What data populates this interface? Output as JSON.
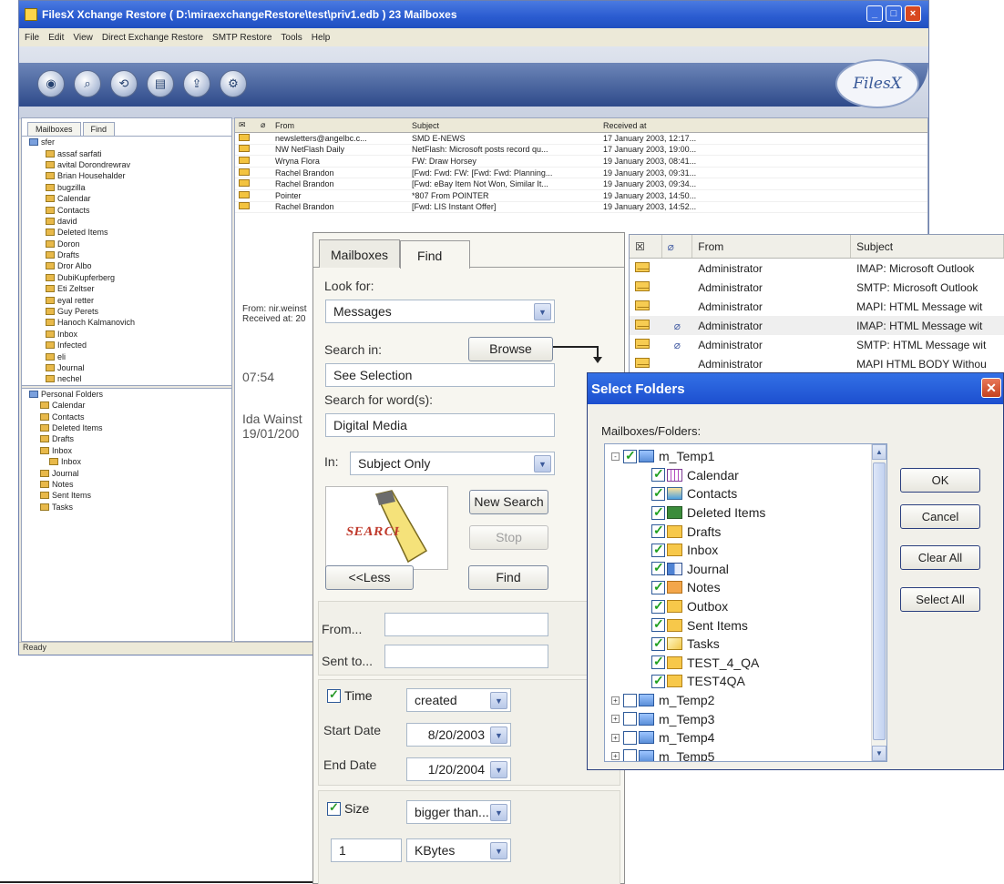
{
  "main_window": {
    "title": "FilesX Xchange Restore ( D:\\miraexchangeRestore\\test\\priv1.edb ) 23 Mailboxes",
    "menu": [
      "File",
      "Edit",
      "View",
      "Direct Exchange Restore",
      "SMTP Restore",
      "Tools",
      "Help"
    ],
    "brand": "FilesX",
    "left_tabs": [
      "Mailboxes",
      "Find"
    ],
    "mailbox_tree_root": "sfer",
    "mailbox_tree": [
      "assaf sarfati",
      "avital Dorondrewrav",
      "Brian Househalder",
      "bugzilla",
      "Calendar",
      "Contacts",
      "david",
      "Deleted Items",
      "Doron",
      "Drafts",
      "Dror Albo",
      "DubiKupferberg",
      "Eti Zeltser",
      "eyal retter",
      "Guy Perets",
      "Hanoch Kalmanovich",
      "Inbox",
      "Infected",
      "eli",
      "Journal",
      "nechel"
    ],
    "pst_tree": [
      "Personal Folders",
      "Calendar",
      "Contacts",
      "Deleted Items",
      "Drafts",
      "Inbox",
      "Inbox",
      "Journal",
      "Notes",
      "Sent Items",
      "Tasks"
    ],
    "msg_columns": [
      "From",
      "Subject",
      "Received at"
    ],
    "messages": [
      {
        "from": "newsletters@angelbc.c...",
        "subject": "SMD E-NEWS",
        "date": "17 January 2003, 12:17..."
      },
      {
        "from": "NW NetFlash Daily",
        "subject": "NetFlash: Microsoft posts record qu...",
        "date": "17 January 2003, 19:00..."
      },
      {
        "from": "Wryna Flora",
        "subject": "FW: Draw Horsey",
        "date": "19 January 2003, 08:41..."
      },
      {
        "from": "Rachel Brandon",
        "subject": "[Fwd: Fwd: FW: [Fwd: Fwd: Planning...",
        "date": "19 January 2003, 09:31..."
      },
      {
        "from": "Rachel Brandon",
        "subject": "[Fwd: eBay Item Not Won, Similar It...",
        "date": "19 January 2003, 09:34..."
      },
      {
        "from": "Pointer",
        "subject": "*807 From POINTER",
        "date": "19 January 2003, 14:50..."
      },
      {
        "from": "Rachel Brandon",
        "subject": "[Fwd: LIS Instant Offer]",
        "date": "19 January 2003, 14:52..."
      }
    ],
    "preview_header_from": "From: nir.weinst",
    "preview_header_received": "Received at: 20",
    "preview_time": "07:54",
    "preview_name": "Ida Wainst",
    "preview_date": "19/01/200",
    "status": "Ready"
  },
  "front_list": {
    "columns": [
      "From",
      "Subject"
    ],
    "rows": [
      {
        "from": "Administrator",
        "subject": "IMAP: Microsoft Outlook",
        "attach": false
      },
      {
        "from": "Administrator",
        "subject": "SMTP: Microsoft Outlook",
        "attach": false
      },
      {
        "from": "Administrator",
        "subject": "MAPI: HTML Message wit",
        "attach": false
      },
      {
        "from": "Administrator",
        "subject": "IMAP: HTML Message wit",
        "attach": true
      },
      {
        "from": "Administrator",
        "subject": "SMTP: HTML Message wit",
        "attach": true
      },
      {
        "from": "Administrator",
        "subject": "MAPI HTML BODY Withou",
        "attach": false
      }
    ]
  },
  "find_panel": {
    "tabs": [
      "Mailboxes",
      "Find"
    ],
    "look_for_label": "Look for:",
    "look_for_value": "Messages",
    "search_in_label": "Search in:",
    "browse_label": "Browse",
    "search_in_value": "See Selection",
    "search_words_label": "Search for word(s):",
    "search_words_value": "Digital Media",
    "in_label": "In:",
    "in_value": "Subject Only",
    "graphic_text": "SEARCH",
    "new_search_label": "New Search",
    "stop_label": "Stop",
    "less_label": "<<Less",
    "find_label": "Find",
    "from_label": "From...",
    "sent_to_label": "Sent to...",
    "time_label": "Time",
    "time_value": "created",
    "start_date_label": "Start Date",
    "start_date_value": "8/20/2003",
    "end_date_label": "End Date",
    "end_date_value": "1/20/2004",
    "size_label": "Size",
    "size_value": "bigger than...",
    "size_amount": "1",
    "size_unit": "KBytes"
  },
  "select_folders": {
    "title": "Select Folders",
    "label": "Mailboxes/Folders:",
    "tree": [
      {
        "name": "m_Temp1",
        "level": 0,
        "checked": true,
        "expander": "-",
        "icon": "mbox"
      },
      {
        "name": "Calendar",
        "level": 1,
        "checked": true,
        "icon": "cal"
      },
      {
        "name": "Contacts",
        "level": 1,
        "checked": true,
        "icon": "contacts"
      },
      {
        "name": "Deleted Items",
        "level": 1,
        "checked": true,
        "icon": "trash"
      },
      {
        "name": "Drafts",
        "level": 1,
        "checked": true,
        "icon": "mail"
      },
      {
        "name": "Inbox",
        "level": 1,
        "checked": true,
        "icon": "mail"
      },
      {
        "name": "Journal",
        "level": 1,
        "checked": true,
        "icon": "journal"
      },
      {
        "name": "Notes",
        "level": 1,
        "checked": true,
        "icon": "notes"
      },
      {
        "name": "Outbox",
        "level": 1,
        "checked": true,
        "icon": "mail"
      },
      {
        "name": "Sent Items",
        "level": 1,
        "checked": true,
        "icon": "mail"
      },
      {
        "name": "Tasks",
        "level": 1,
        "checked": true,
        "icon": "tasks"
      },
      {
        "name": "TEST_4_QA",
        "level": 1,
        "checked": true,
        "icon": "mail"
      },
      {
        "name": "TEST4QA",
        "level": 1,
        "checked": true,
        "icon": "mail"
      },
      {
        "name": "m_Temp2",
        "level": 0,
        "checked": false,
        "expander": "+",
        "icon": "mbox"
      },
      {
        "name": "m_Temp3",
        "level": 0,
        "checked": false,
        "expander": "+",
        "icon": "mbox"
      },
      {
        "name": "m_Temp4",
        "level": 0,
        "checked": false,
        "expander": "+",
        "icon": "mbox"
      },
      {
        "name": "m_Temp5",
        "level": 0,
        "checked": false,
        "expander": "+",
        "icon": "mbox"
      }
    ],
    "ok_label": "OK",
    "cancel_label": "Cancel",
    "clear_all_label": "Clear All",
    "select_all_label": "Select All"
  }
}
